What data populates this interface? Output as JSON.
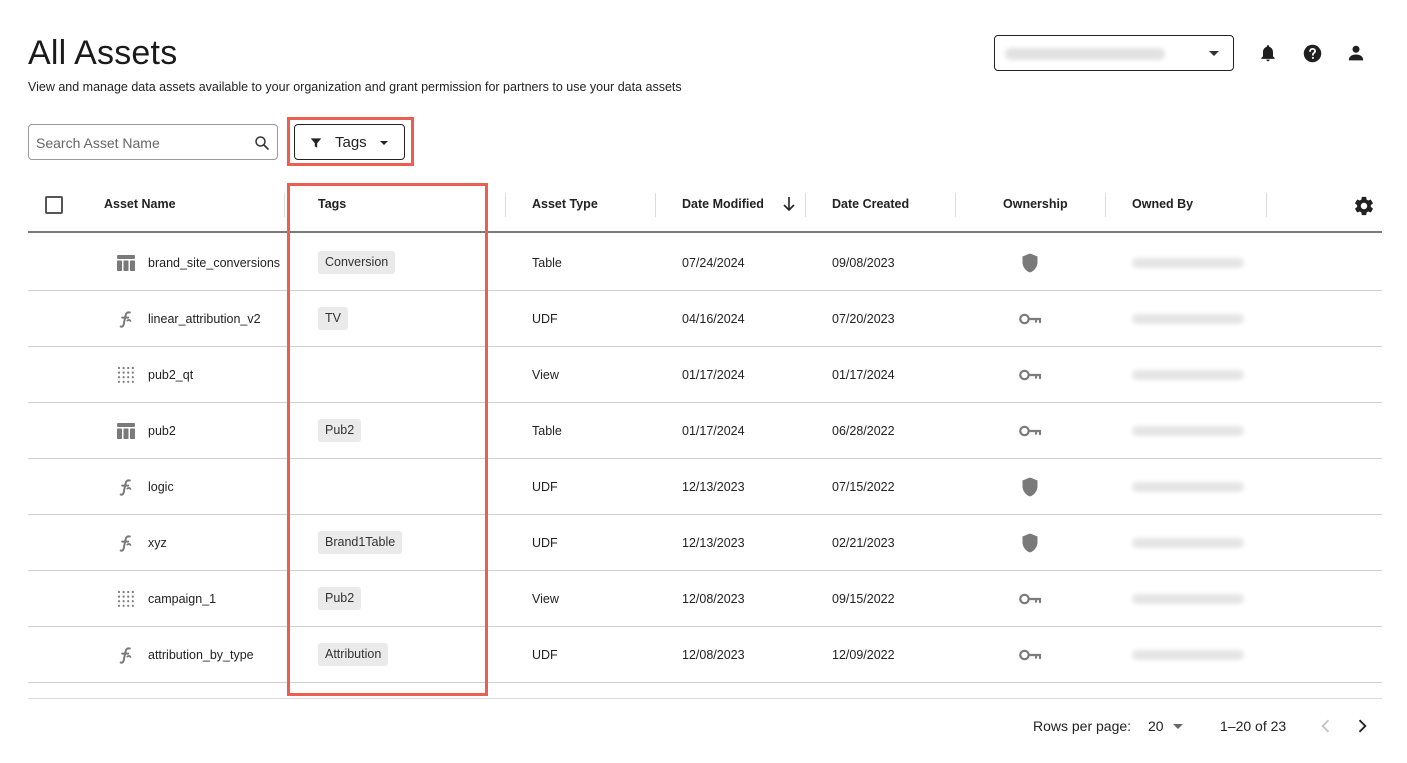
{
  "header": {
    "title": "All Assets",
    "subtitle": "View and manage data assets available to your organization and grant permission for partners to use your data assets",
    "icons": [
      "bell-icon",
      "help-icon",
      "user-icon"
    ]
  },
  "toolbar": {
    "search_placeholder": "Search Asset Name",
    "search_value": "",
    "tags_label": "Tags"
  },
  "table": {
    "columns": [
      "Asset Name",
      "Tags",
      "Asset Type",
      "Date Modified",
      "Date Created",
      "Ownership",
      "Owned By"
    ],
    "sort": {
      "column": "Date Modified",
      "direction": "descending"
    },
    "rows": [
      {
        "icon": "table-icon",
        "name": "brand_site_conversions",
        "tag": "Conversion",
        "type": "Table",
        "modified": "07/24/2024",
        "created": "09/08/2023",
        "ownership": "shield-icon"
      },
      {
        "icon": "function-icon",
        "name": "linear_attribution_v2",
        "tag": "TV",
        "type": "UDF",
        "modified": "04/16/2024",
        "created": "07/20/2023",
        "ownership": "key-icon"
      },
      {
        "icon": "view-icon",
        "name": "pub2_qt",
        "tag": "",
        "type": "View",
        "modified": "01/17/2024",
        "created": "01/17/2024",
        "ownership": "key-icon"
      },
      {
        "icon": "table-icon",
        "name": "pub2",
        "tag": "Pub2",
        "type": "Table",
        "modified": "01/17/2024",
        "created": "06/28/2022",
        "ownership": "key-icon"
      },
      {
        "icon": "function-icon",
        "name": "logic",
        "tag": "",
        "type": "UDF",
        "modified": "12/13/2023",
        "created": "07/15/2022",
        "ownership": "shield-icon"
      },
      {
        "icon": "function-icon",
        "name": "xyz",
        "tag": "Brand1Table",
        "type": "UDF",
        "modified": "12/13/2023",
        "created": "02/21/2023",
        "ownership": "shield-icon"
      },
      {
        "icon": "view-icon",
        "name": "campaign_1",
        "tag": "Pub2",
        "type": "View",
        "modified": "12/08/2023",
        "created": "09/15/2022",
        "ownership": "key-icon"
      },
      {
        "icon": "function-icon",
        "name": "attribution_by_type",
        "tag": "Attribution",
        "type": "UDF",
        "modified": "12/08/2023",
        "created": "12/09/2022",
        "ownership": "key-icon"
      }
    ]
  },
  "pagination": {
    "rows_per_page_label": "Rows per page:",
    "rows_per_page": "20",
    "range": "1–20 of 23"
  },
  "colors": {
    "highlight": "#ec5f50",
    "tag_bg": "#eaeaea",
    "icon": "#7a7a7a"
  }
}
